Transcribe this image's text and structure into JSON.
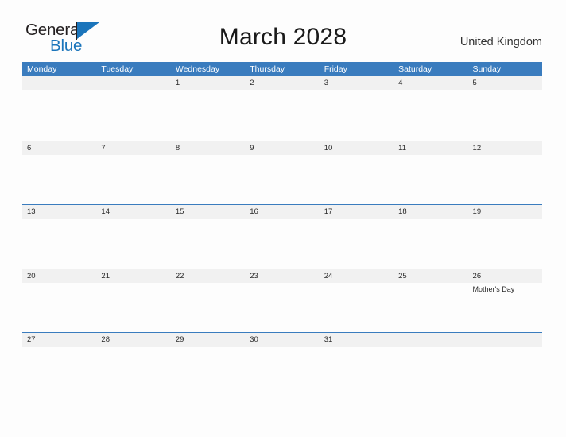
{
  "brand": {
    "name_part1": "General",
    "name_part2": "Blue",
    "flag_icon": "triangle-flag-icon",
    "accent_color": "#1b75bb"
  },
  "header": {
    "title": "March 2028",
    "region": "United Kingdom"
  },
  "colors": {
    "weekday_header_bg": "#3a7cbe",
    "weekday_header_text": "#ffffff",
    "date_band_bg": "#f1f1f1",
    "row_separator": "#3a7cbe",
    "page_bg": "#fdfdfd",
    "text": "#2b2b2b"
  },
  "calendar": {
    "weekdays": [
      "Monday",
      "Tuesday",
      "Wednesday",
      "Thursday",
      "Friday",
      "Saturday",
      "Sunday"
    ],
    "weeks": [
      [
        {
          "date": "",
          "events": []
        },
        {
          "date": "",
          "events": []
        },
        {
          "date": "1",
          "events": []
        },
        {
          "date": "2",
          "events": []
        },
        {
          "date": "3",
          "events": []
        },
        {
          "date": "4",
          "events": []
        },
        {
          "date": "5",
          "events": []
        }
      ],
      [
        {
          "date": "6",
          "events": []
        },
        {
          "date": "7",
          "events": []
        },
        {
          "date": "8",
          "events": []
        },
        {
          "date": "9",
          "events": []
        },
        {
          "date": "10",
          "events": []
        },
        {
          "date": "11",
          "events": []
        },
        {
          "date": "12",
          "events": []
        }
      ],
      [
        {
          "date": "13",
          "events": []
        },
        {
          "date": "14",
          "events": []
        },
        {
          "date": "15",
          "events": []
        },
        {
          "date": "16",
          "events": []
        },
        {
          "date": "17",
          "events": []
        },
        {
          "date": "18",
          "events": []
        },
        {
          "date": "19",
          "events": []
        }
      ],
      [
        {
          "date": "20",
          "events": []
        },
        {
          "date": "21",
          "events": []
        },
        {
          "date": "22",
          "events": []
        },
        {
          "date": "23",
          "events": []
        },
        {
          "date": "24",
          "events": []
        },
        {
          "date": "25",
          "events": []
        },
        {
          "date": "26",
          "events": [
            "Mother's Day"
          ]
        }
      ],
      [
        {
          "date": "27",
          "events": []
        },
        {
          "date": "28",
          "events": []
        },
        {
          "date": "29",
          "events": []
        },
        {
          "date": "30",
          "events": []
        },
        {
          "date": "31",
          "events": []
        },
        {
          "date": "",
          "events": []
        },
        {
          "date": "",
          "events": []
        }
      ]
    ]
  }
}
